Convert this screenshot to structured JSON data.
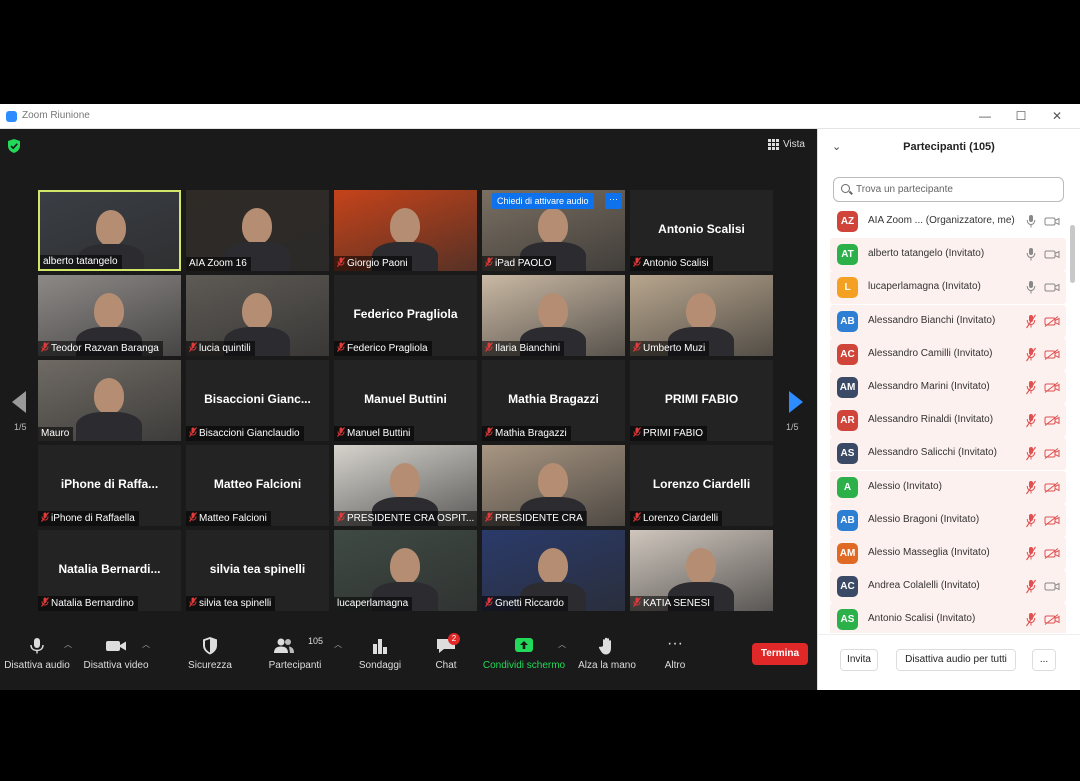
{
  "window": {
    "title": "Zoom Riunione",
    "controls": [
      "—",
      "☐",
      "✕"
    ]
  },
  "top_bar": {
    "view_label": "Vista"
  },
  "tiles": [
    {
      "name": "alberto tatangelo",
      "muted": false,
      "video": true,
      "active": true,
      "bg": "#3a3e44"
    },
    {
      "name": "AIA Zoom 16",
      "muted": false,
      "video": true,
      "bg": "#2f2a26"
    },
    {
      "name": "Giorgio Paoni",
      "muted": true,
      "video": true,
      "bg": "#c5431a"
    },
    {
      "name": "iPad PAOLO",
      "muted": true,
      "video": true,
      "bg": "#7a6f62",
      "ask_unmute": "Chiedi di attivare audio",
      "more": "···"
    },
    {
      "name": "Antonio Scalisi",
      "muted": true,
      "video": false,
      "big": "Antonio Scalisi"
    },
    {
      "name": "Teodor Razvan Baranga",
      "muted": true,
      "video": true,
      "bg": "#8d8987"
    },
    {
      "name": "lucia quintili",
      "muted": true,
      "video": true,
      "bg": "#5e5a55"
    },
    {
      "name": "Federico Pragliola",
      "muted": true,
      "video": false,
      "big": "Federico Pragliola"
    },
    {
      "name": "Ilaria Bianchini",
      "muted": true,
      "video": true,
      "bg": "#c9b8a3"
    },
    {
      "name": "Umberto Muzi",
      "muted": true,
      "video": true,
      "bg": "#b8a68e"
    },
    {
      "name": "Mauro",
      "muted": false,
      "video": true,
      "bg": "#6f6a64"
    },
    {
      "name": "Bisaccioni Gianclaudio",
      "muted": true,
      "video": false,
      "big": "Bisaccioni Gianc..."
    },
    {
      "name": "Manuel Buttini",
      "muted": true,
      "video": false,
      "big": "Manuel Buttini"
    },
    {
      "name": "Mathia Bragazzi",
      "muted": true,
      "video": false,
      "big": "Mathia Bragazzi"
    },
    {
      "name": "PRIMI FABIO",
      "muted": true,
      "video": false,
      "big": "PRIMI FABIO"
    },
    {
      "name": "iPhone di Raffaella",
      "muted": true,
      "video": false,
      "big": "iPhone di Raffa..."
    },
    {
      "name": "Matteo Falcioni",
      "muted": true,
      "video": false,
      "big": "Matteo Falcioni"
    },
    {
      "name": "PRESIDENTE CRA OSPIT...",
      "muted": true,
      "video": true,
      "bg": "#d6d3cd"
    },
    {
      "name": "PRESIDENTE CRA",
      "muted": true,
      "video": true,
      "bg": "#a89682"
    },
    {
      "name": "Lorenzo Ciardelli",
      "muted": true,
      "video": false,
      "big": "Lorenzo Ciardelli"
    },
    {
      "name": "Natalia Bernardino",
      "muted": true,
      "video": false,
      "big": "Natalia  Bernardi..."
    },
    {
      "name": "silvia tea spinelli",
      "muted": true,
      "video": false,
      "big": "silvia tea spinelli"
    },
    {
      "name": "lucaperlamagna",
      "muted": false,
      "video": true,
      "bg": "#3f4a44"
    },
    {
      "name": "Gnetti Riccardo",
      "muted": true,
      "video": true,
      "bg": "#2a3a6a"
    },
    {
      "name": "KATIA SENESI",
      "muted": true,
      "video": true,
      "bg": "#cfc6bd"
    }
  ],
  "pagination": {
    "left": "1/5",
    "right": "1/5"
  },
  "toolbar": {
    "mute": "Disattiva audio",
    "video": "Disattiva video",
    "security": "Sicurezza",
    "participants": "Partecipanti",
    "participants_count": "105",
    "polls": "Sondaggi",
    "chat": "Chat",
    "chat_badge": "2",
    "share": "Condividi schermo",
    "raise_hand": "Alza la mano",
    "more": "Altro",
    "end": "Termina"
  },
  "panel": {
    "title": "Partecipanti (105)",
    "search_placeholder": "Trova un partecipante",
    "participants": [
      {
        "initials": "AZ",
        "color": "#d0453a",
        "name": "AIA Zoom ... (Organizzatore, me)",
        "mic": "on",
        "cam": "on"
      },
      {
        "initials": "AT",
        "color": "#2bb04a",
        "name": "alberto tatangelo (Invitato)",
        "mic": "on",
        "cam": "on"
      },
      {
        "initials": "L",
        "color": "#f4a023",
        "name": "lucaperlamagna (Invitato)",
        "mic": "on",
        "cam": "on"
      },
      {
        "initials": "AB",
        "color": "#2d7fd3",
        "name": "Alessandro Bianchi (Invitato)",
        "mic": "off",
        "cam": "off"
      },
      {
        "initials": "AC",
        "color": "#d0453a",
        "name": "Alessandro Camilli (Invitato)",
        "mic": "off",
        "cam": "off"
      },
      {
        "initials": "AM",
        "color": "#3a4a66",
        "name": "Alessandro Marini (Invitato)",
        "mic": "off",
        "cam": "off"
      },
      {
        "initials": "AR",
        "color": "#d0453a",
        "name": "Alessandro Rinaldi (Invitato)",
        "mic": "off",
        "cam": "off"
      },
      {
        "initials": "AS",
        "color": "#3a4a66",
        "name": "Alessandro Salicchi (Invitato)",
        "mic": "off",
        "cam": "off"
      },
      {
        "initials": "A",
        "color": "#2bb04a",
        "name": "Alessio (Invitato)",
        "mic": "off",
        "cam": "off"
      },
      {
        "initials": "AB",
        "color": "#2d7fd3",
        "name": "Alessio Bragoni (Invitato)",
        "mic": "off",
        "cam": "off"
      },
      {
        "initials": "AM",
        "color": "#e06a24",
        "name": "Alessio Masseglia (Invitato)",
        "mic": "off",
        "cam": "off"
      },
      {
        "initials": "AC",
        "color": "#3a4a66",
        "name": "Andrea Colalelli (Invitato)",
        "mic": "off",
        "cam": "on"
      },
      {
        "initials": "AS",
        "color": "#2bb04a",
        "name": "Antonio Scalisi (Invitato)",
        "mic": "off",
        "cam": "off"
      }
    ],
    "invite": "Invita",
    "mute_all": "Disattiva audio per tutti",
    "more": "..."
  }
}
